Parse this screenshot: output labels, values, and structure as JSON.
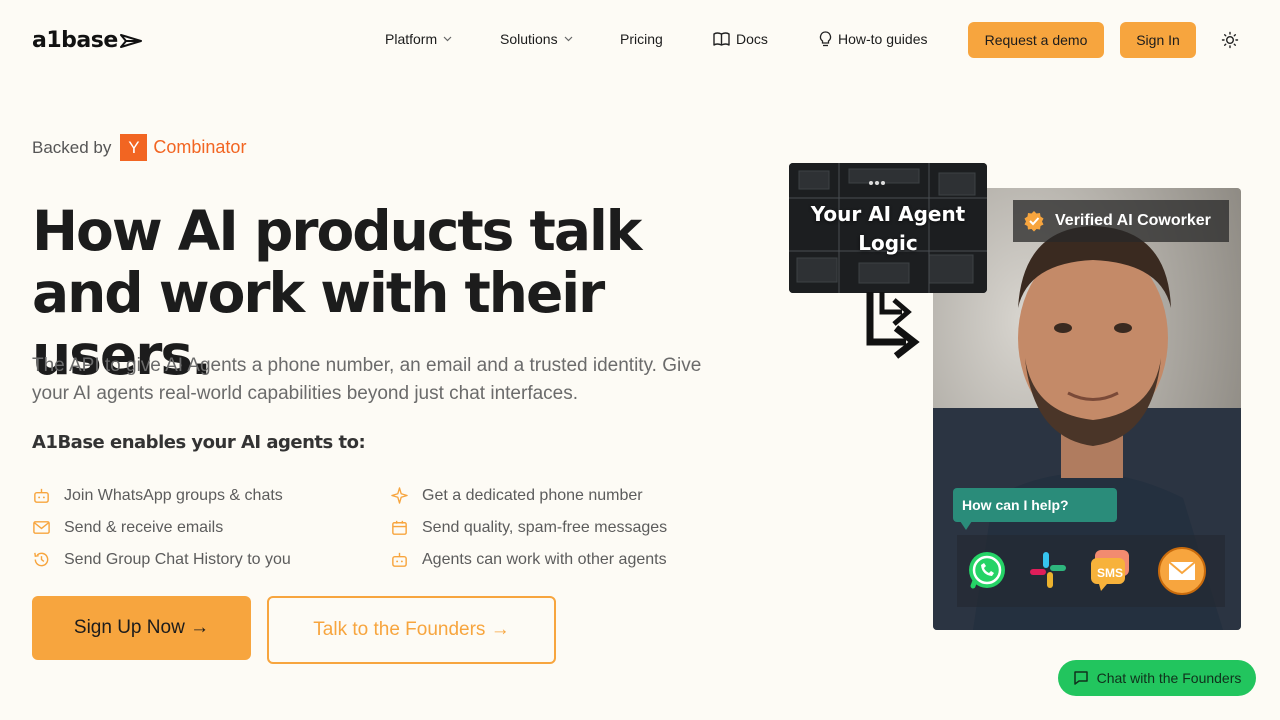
{
  "nav": {
    "logo_text": "a1base",
    "platform": "Platform",
    "solutions": "Solutions",
    "pricing": "Pricing",
    "docs": "Docs",
    "howto": "How-to guides",
    "request_demo": "Request a demo",
    "sign_in": "Sign In"
  },
  "hero": {
    "backed_by": "Backed by",
    "yc_letter": "Y",
    "yc_word": "Combinator",
    "title": "How AI products talk and work with their users.",
    "subtitle": "The API to give AI Agents a phone number, an email and a trusted identity. Give your AI agents real-world capabilities beyond just chat interfaces.",
    "enables_heading": "A1Base enables your AI agents to:",
    "features": [
      {
        "label": "Join WhatsApp groups & chats",
        "icon": "bot-icon"
      },
      {
        "label": "Get a dedicated phone number",
        "icon": "sparkle-icon"
      },
      {
        "label": "Send & receive emails",
        "icon": "mail-icon"
      },
      {
        "label": "Send quality, spam-free messages",
        "icon": "calendar-icon"
      },
      {
        "label": "Send Group Chat History to you",
        "icon": "history-icon"
      },
      {
        "label": "Agents can work with other agents",
        "icon": "bot-icon"
      }
    ],
    "signup_button": "Sign Up Now →",
    "founders_button": "Talk to the Founders →"
  },
  "visual": {
    "agent_logic": "Your AI Agent Logic",
    "verified": "Verified AI Coworker",
    "chat_bubble": "How can I help?",
    "sms_label": "SMS",
    "channel_icons": [
      "whatsapp-icon",
      "slack-icon",
      "sms-icon",
      "email-icon"
    ]
  },
  "chat_widget": "Chat with the Founders",
  "colors": {
    "background": "#fdfbf5",
    "accent": "#f7a53e",
    "yc_orange": "#f26522",
    "bubble": "#2a8c7a",
    "chat_green": "#22c55e"
  }
}
